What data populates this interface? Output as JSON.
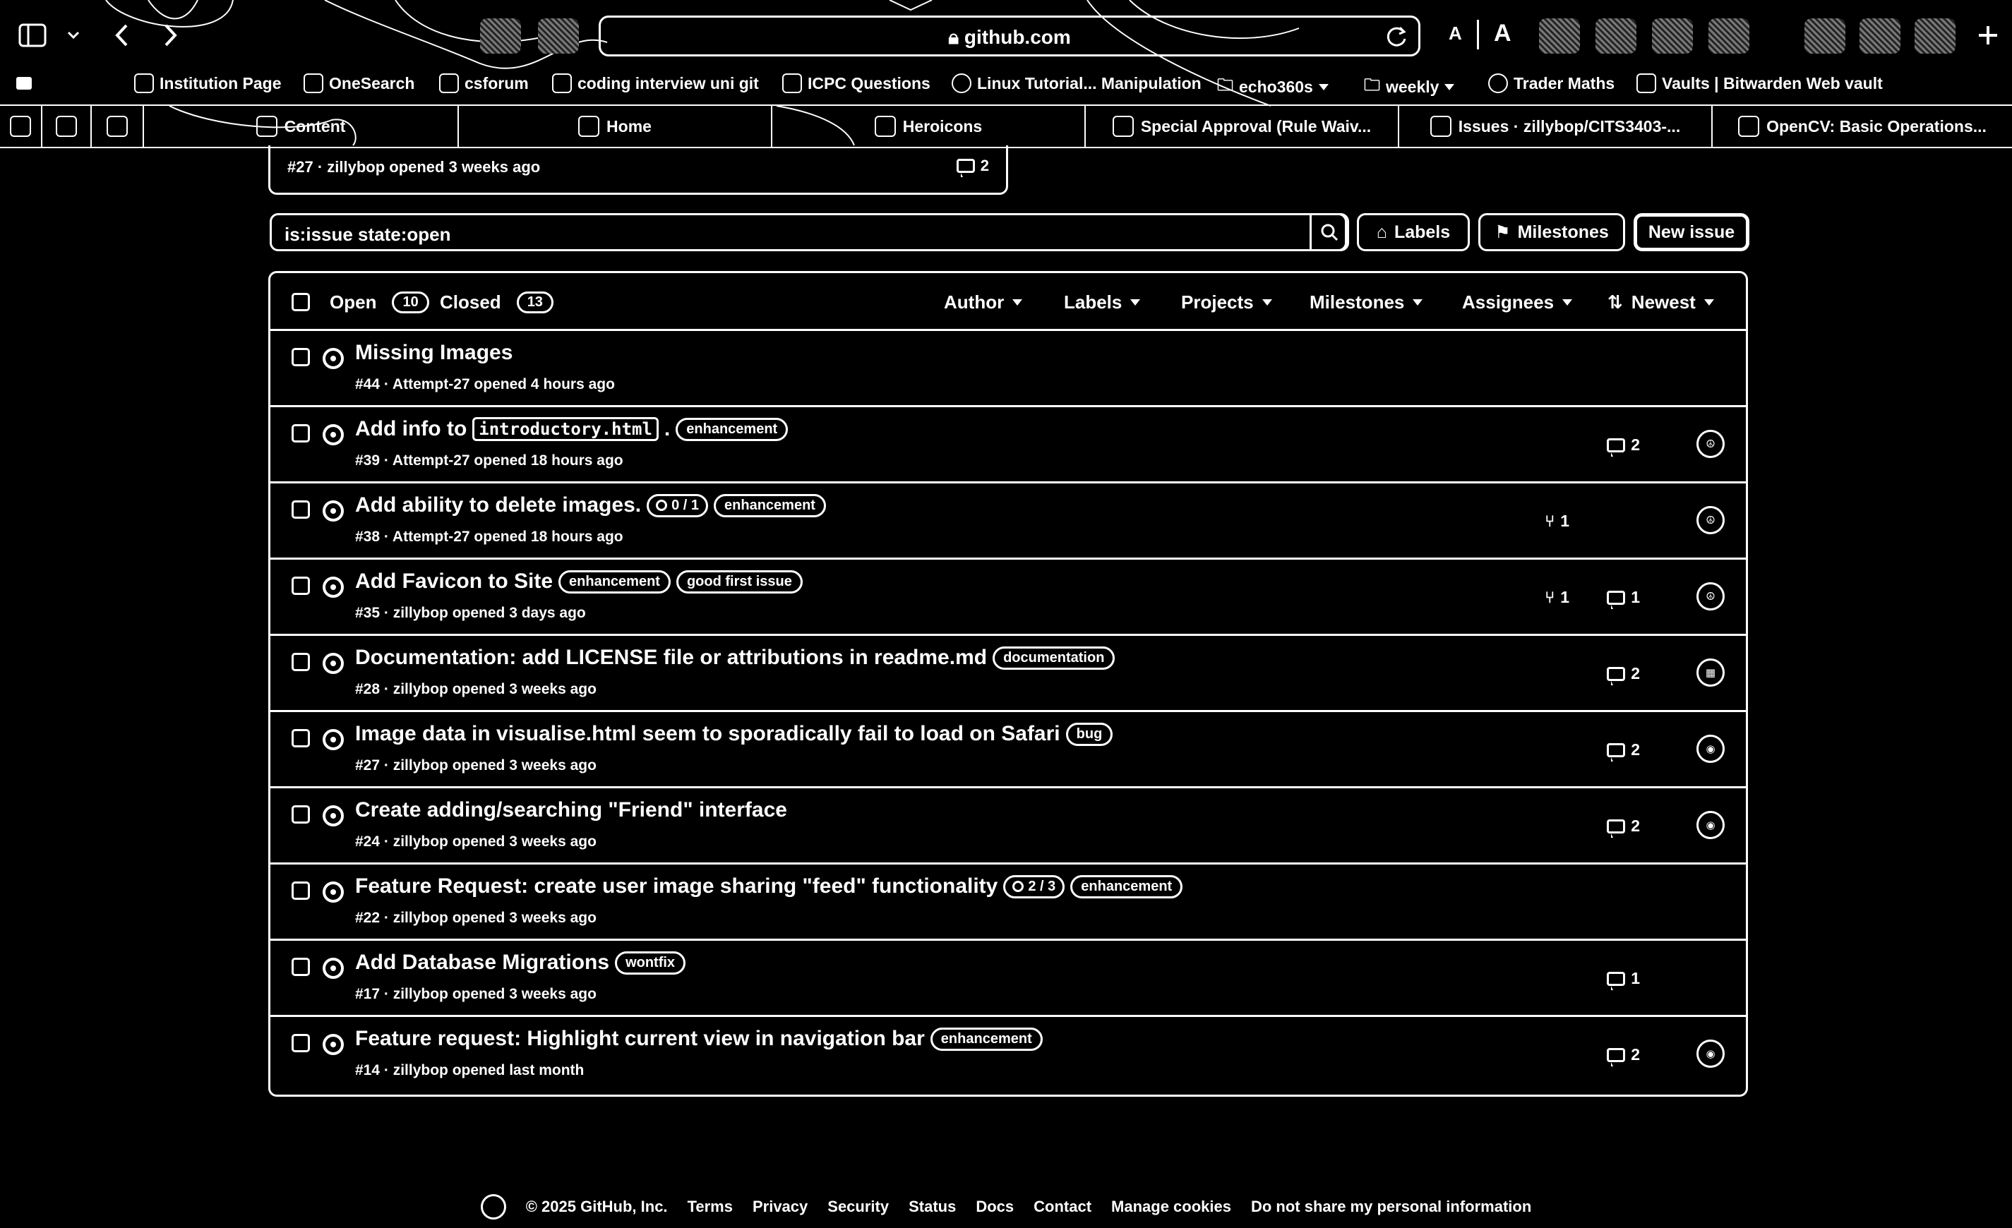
{
  "browser": {
    "url": "github.com",
    "text_size_small": "A",
    "text_size_large": "A"
  },
  "bookmarks": [
    {
      "label": "Institution Page"
    },
    {
      "label": "OneSearch"
    },
    {
      "label": "csforum"
    },
    {
      "label": "coding interview uni git"
    },
    {
      "label": "ICPC Questions"
    },
    {
      "label": "Linux Tutorial... Manipulation"
    },
    {
      "label": "echo360s"
    },
    {
      "label": "weekly"
    },
    {
      "label": "Trader Maths"
    },
    {
      "label": "Vaults | Bitwarden Web vault"
    }
  ],
  "tabs": [
    {
      "label": "Content"
    },
    {
      "label": "Home"
    },
    {
      "label": "Heroicons"
    },
    {
      "label": "Special Approval (Rule Waiv..."
    },
    {
      "label": "Issues · zillybop/CITS3403-..."
    },
    {
      "label": "OpenCV: Basic Operations..."
    }
  ],
  "previous_card": {
    "meta": "#27 · zillybop opened 3 weeks ago",
    "comments": "2"
  },
  "search": {
    "query": "is:issue state:open"
  },
  "actions": {
    "labels": "Labels",
    "milestones": "Milestones",
    "new_issue": "New issue"
  },
  "issues_header": {
    "open_label": "Open",
    "open_count": "10",
    "closed_label": "Closed",
    "closed_count": "13",
    "filters": [
      "Author",
      "Labels",
      "Projects",
      "Milestones",
      "Assignees",
      "Newest"
    ]
  },
  "issues": [
    {
      "title": "Missing Images",
      "meta": "#44 · Attempt-27 opened 4 hours ago"
    },
    {
      "title": "Add info to",
      "code": "introductory.html",
      "after_code": ".",
      "labels": [
        "enhancement"
      ],
      "meta": "#39 · Attempt-27 opened 18 hours ago",
      "comments": "2",
      "avatar": "☮"
    },
    {
      "title": "Add ability to delete images.",
      "progress": "0 / 1",
      "labels": [
        "enhancement"
      ],
      "meta": "#38 · Attempt-27 opened 18 hours ago",
      "prs": "1",
      "avatar": "☮"
    },
    {
      "title": "Add Favicon to Site",
      "labels": [
        "enhancement",
        "good first issue"
      ],
      "meta": "#35 · zillybop opened 3 days ago",
      "prs": "1",
      "comments": "1",
      "avatar": "☮"
    },
    {
      "title": "Documentation: add LICENSE file or attributions in readme.md",
      "labels": [
        "documentation"
      ],
      "meta": "#28 · zillybop opened 3 weeks ago",
      "comments": "2",
      "avatar": "▦"
    },
    {
      "title": "Image data in visualise.html seem to sporadically fail to load on Safari",
      "labels": [
        "bug"
      ],
      "meta": "#27 · zillybop opened 3 weeks ago",
      "comments": "2",
      "avatar": "◉"
    },
    {
      "title": "Create adding/searching \"Friend\" interface",
      "meta": "#24 · zillybop opened 3 weeks ago",
      "comments": "2",
      "avatar": "◉"
    },
    {
      "title": "Feature Request: create user image sharing \"feed\" functionality",
      "progress": "2 / 3",
      "labels": [
        "enhancement"
      ],
      "meta": "#22 · zillybop opened 3 weeks ago"
    },
    {
      "title": "Add Database Migrations",
      "labels": [
        "wontfix"
      ],
      "meta": "#17 · zillybop opened 3 weeks ago",
      "comments": "1"
    },
    {
      "title": "Feature request: Highlight current view in navigation bar",
      "labels": [
        "enhancement"
      ],
      "meta": "#14 · zillybop opened last month",
      "comments": "2",
      "avatar": "◉"
    }
  ],
  "footer": {
    "copyright": "© 2025 GitHub, Inc.",
    "links": [
      "Terms",
      "Privacy",
      "Security",
      "Status",
      "Docs",
      "Contact",
      "Manage cookies",
      "Do not share my personal information"
    ]
  }
}
